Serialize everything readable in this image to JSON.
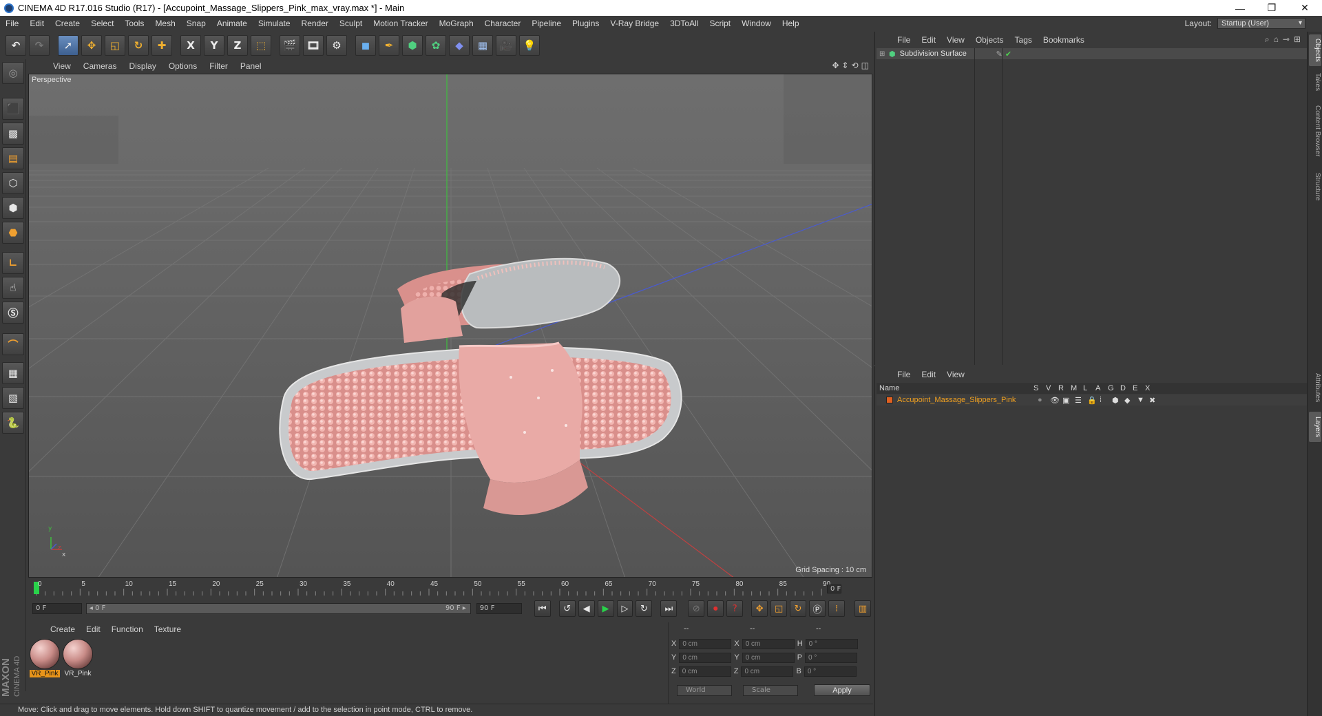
{
  "window": {
    "title": "CINEMA 4D R17.016 Studio (R17) - [Accupoint_Massage_Slippers_Pink_max_vray.max *] - Main",
    "controls": {
      "minimize": "—",
      "restore": "❐",
      "close": "✕"
    }
  },
  "menubar": {
    "items": [
      "File",
      "Edit",
      "Create",
      "Select",
      "Tools",
      "Mesh",
      "Snap",
      "Animate",
      "Simulate",
      "Render",
      "Sculpt",
      "Motion Tracker",
      "MoGraph",
      "Character",
      "Pipeline",
      "Plugins",
      "V-Ray Bridge",
      "3DToAll",
      "Script",
      "Window",
      "Help"
    ],
    "layout_label": "Layout:",
    "layout_value": "Startup (User)"
  },
  "toolbar": {
    "axis_x": "X",
    "axis_y": "Y",
    "axis_z": "Z"
  },
  "viewport": {
    "menu": [
      "View",
      "Cameras",
      "Display",
      "Options",
      "Filter",
      "Panel"
    ],
    "label": "Perspective",
    "grid_spacing": "Grid Spacing : 10 cm",
    "axis_y": "y",
    "axis_z": "z",
    "axis_x": "x"
  },
  "timeline": {
    "ticks": [
      "0",
      "5",
      "10",
      "15",
      "20",
      "25",
      "30",
      "35",
      "40",
      "45",
      "50",
      "55",
      "60",
      "65",
      "70",
      "75",
      "80",
      "85",
      "90"
    ],
    "current_frame": "0 F",
    "start_field": "0 F",
    "range_start": "◂ 0 F",
    "range_end": "90 F ▸",
    "end_field": "90 F"
  },
  "materials": {
    "menu": [
      "Create",
      "Edit",
      "Function",
      "Texture"
    ],
    "items": [
      {
        "label": "VR_Pink",
        "selected": true
      },
      {
        "label": "VR_Pink",
        "selected": false
      }
    ]
  },
  "coords": {
    "header": [
      "--",
      "--",
      "--"
    ],
    "rows": [
      {
        "a": "X",
        "av": "0 cm",
        "b": "X",
        "bv": "0 cm",
        "c": "H",
        "cv": "0 °"
      },
      {
        "a": "Y",
        "av": "0 cm",
        "b": "Y",
        "bv": "0 cm",
        "c": "P",
        "cv": "0 °"
      },
      {
        "a": "Z",
        "av": "0 cm",
        "b": "Z",
        "bv": "0 cm",
        "c": "B",
        "cv": "0 °"
      }
    ],
    "mode": "World",
    "scale": "Scale",
    "apply": "Apply"
  },
  "status": {
    "text": "Move: Click and drag to move elements. Hold down SHIFT to quantize movement / add to the selection in point mode, CTRL to remove."
  },
  "objects_panel": {
    "menu": [
      "File",
      "Edit",
      "View",
      "Objects",
      "Tags",
      "Bookmarks"
    ],
    "object_name": "Subdivision Surface"
  },
  "layers_panel": {
    "menu": [
      "File",
      "Edit",
      "View"
    ],
    "columns": [
      "Name",
      "S",
      "V",
      "R",
      "M",
      "L",
      "A",
      "G",
      "D",
      "E",
      "X"
    ],
    "layer_name": "Accupoint_Massage_Slippers_Pink"
  },
  "right_tabs": [
    "Objects",
    "Takes",
    "Content Browser",
    "Structure",
    "Attributes",
    "Layers"
  ],
  "logo": {
    "line1": "MAXON",
    "line2": "CINEMA 4D"
  },
  "colors": {
    "accent_orange": "#e8941a",
    "selection_blue": "#3d5f8f",
    "slipper_pink": "#e8a8a8"
  }
}
